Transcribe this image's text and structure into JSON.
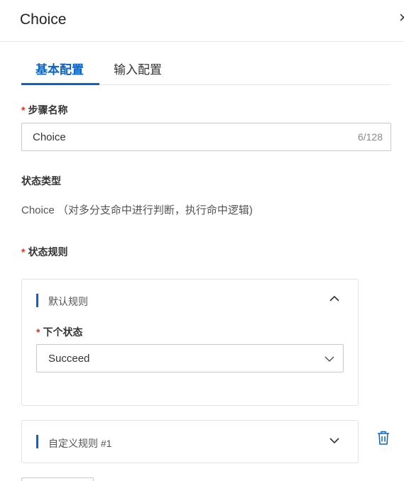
{
  "header": {
    "title": "Choice",
    "close_glyph": "×"
  },
  "tabs": [
    {
      "label": "基本配置",
      "active": true
    },
    {
      "label": "输入配置",
      "active": false
    }
  ],
  "form": {
    "step_name": {
      "required_mark": "*",
      "label": "步骤名称",
      "value": "Choice",
      "counter": "6/128"
    },
    "state_type": {
      "label": "状态类型",
      "value": "Choice （对多分支命中进行判断，执行命中逻辑)"
    },
    "state_rules": {
      "required_mark": "*",
      "label": "状态规则",
      "rules": [
        {
          "title": "默认规则",
          "expanded": true,
          "next_state": {
            "required_mark": "*",
            "label": "下个状态",
            "selected": "Succeed"
          }
        },
        {
          "title": "自定义规则 #1",
          "expanded": false
        }
      ]
    }
  },
  "icons": {
    "close": "close-icon",
    "collapse": "chevron-up-icon",
    "expand": "chevron-down-icon",
    "select": "chevron-down-icon",
    "delete": "trash-icon"
  },
  "colors": {
    "accent": "#0a63c7",
    "required": "#d93026"
  }
}
